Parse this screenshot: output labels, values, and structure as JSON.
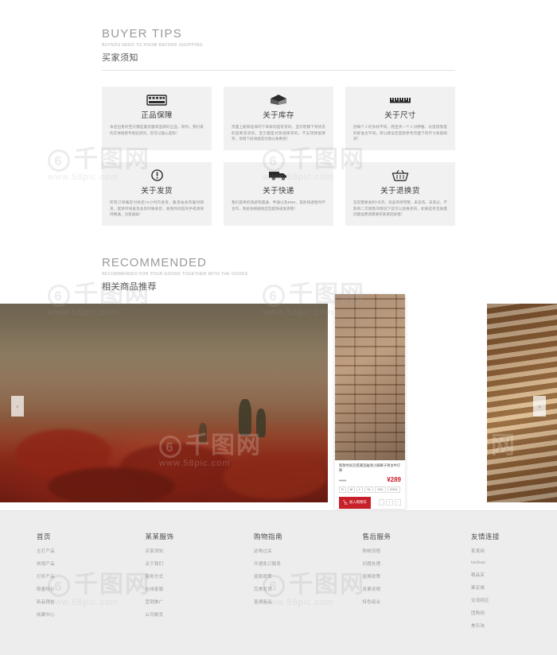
{
  "tips": {
    "heading_en": "BUYER TIPS",
    "heading_sub": "BUYERS NEED TO KNOW BEFORE SHOPPING",
    "heading_cn": "买家须知",
    "cards": [
      {
        "icon": "film-strip-icon",
        "title": "正品保障",
        "body": "本店出售的宝贝都是曼思服饰品牌的正品，同时，我们家的实体接受专柜验货的，您可以放心选购！"
      },
      {
        "icon": "open-box-icon",
        "title": "关于库存",
        "body": "页面上能够选择的下单款均是有货的，显示售罄下架状态的是断货货的，宝贝都是付款减库存的，不支持预留库存，亲稍下前请提前付款以免断货！"
      },
      {
        "icon": "ruler-icon",
        "title": "关于尺寸",
        "body": "因每个人的身材不同，而且买一个人对胖瘦、长度接受度的标准也不同，所以建议您首接参考页面下的尺寸表再购买！"
      },
      {
        "icon": "exclamation-icon",
        "title": "关于发货",
        "body": "所有订单确定付款后72小时内发货，集货站会有临时缺货，配货时排查及会及时联系您，收到时间后的手机请保持畅通，注意查收！"
      },
      {
        "icon": "truck-icon",
        "title": "关于快递",
        "body": "我们提供的快递有圆通、申通以及EMS，其他快递暂时不合作，系统会根据地区匹配快递发货哦！"
      },
      {
        "icon": "basket-icon",
        "title": "关于退换货",
        "body": "在您需要收到7天内，商品吊牌完整、未穿洗、未洗过，不影响二次销售的情况下您可以退换货的，如果是有包质量问题运费请需要买家来回承担！"
      }
    ]
  },
  "recommended": {
    "heading_en": "RECOMMENDED",
    "heading_sub": "RECOMMENDED FOR YOUR GOODS TOGETHER WITH THE GOODS",
    "heading_cn": "相关商品推荐",
    "arrow_prev": "‹",
    "arrow_next": "›"
  },
  "product": {
    "name": "新款时尚百搭潮流破洞小脚裤子男女牛仔裤",
    "price_old": "¥588",
    "price_new": "¥289",
    "sizes": [
      "S",
      "M",
      "L",
      "XL",
      "XXL",
      "XXXL"
    ],
    "cart_label": "加入购物车",
    "cart_icon": "shopping-cart-icon",
    "qty_minus": "-",
    "qty_value": "1",
    "qty_plus": "+"
  },
  "footer": {
    "columns": [
      {
        "title": "首页",
        "links": [
          "主打产品",
          "热销产品",
          "打折产品",
          "限量特价",
          "新品预告",
          "收藏中心"
        ]
      },
      {
        "title": "某某服饰",
        "links": [
          "买家须知",
          "关于我们",
          "服务方式",
          "在线客服",
          "营销推广",
          "公司概览"
        ]
      },
      {
        "title": "购物指南",
        "links": [
          "这物过关",
          "开通免订服务",
          "退款政策",
          "完美发货",
          "普通商品"
        ]
      },
      {
        "title": "售后服务",
        "links": [
          "购物流程",
          "问题处理",
          "退换政策",
          "发票说明",
          "特色组合"
        ]
      },
      {
        "title": "友情连接",
        "links": [
          "某某网",
          "taobao",
          "精品店",
          "聚定城",
          "交流网区",
          "团购网",
          "美乐淘"
        ]
      }
    ]
  },
  "watermarks": {
    "text": "千图网",
    "sub": "www.58pic.com"
  }
}
